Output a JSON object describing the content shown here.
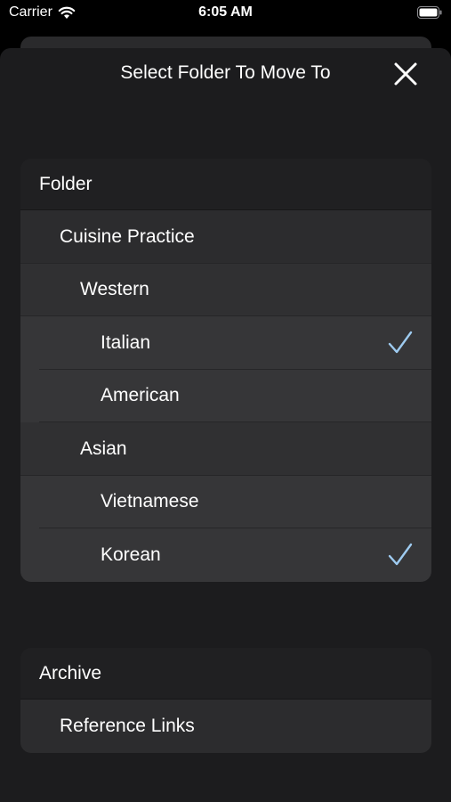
{
  "status_bar": {
    "carrier": "Carrier",
    "time": "6:05 AM"
  },
  "sheet": {
    "title": "Select Folder To Move To",
    "close_icon": "close-icon"
  },
  "groups": [
    {
      "header": "Folder",
      "rows": [
        {
          "label": "Cuisine Practice",
          "level": 1,
          "checked": false
        },
        {
          "label": "Western",
          "level": 2,
          "checked": false
        },
        {
          "label": "Italian",
          "level": 3,
          "checked": true
        },
        {
          "label": "American",
          "level": 3,
          "checked": false
        },
        {
          "label": "Asian",
          "level": 2,
          "checked": false
        },
        {
          "label": "Vietnamese",
          "level": 3,
          "checked": false
        },
        {
          "label": "Korean",
          "level": 3,
          "checked": true
        }
      ]
    },
    {
      "header": "Archive",
      "rows": [
        {
          "label": "Reference Links",
          "level": 1,
          "checked": false
        }
      ]
    }
  ],
  "colors": {
    "accent_check": "#9ecbf0",
    "sheet_background": "#1c1c1e"
  }
}
